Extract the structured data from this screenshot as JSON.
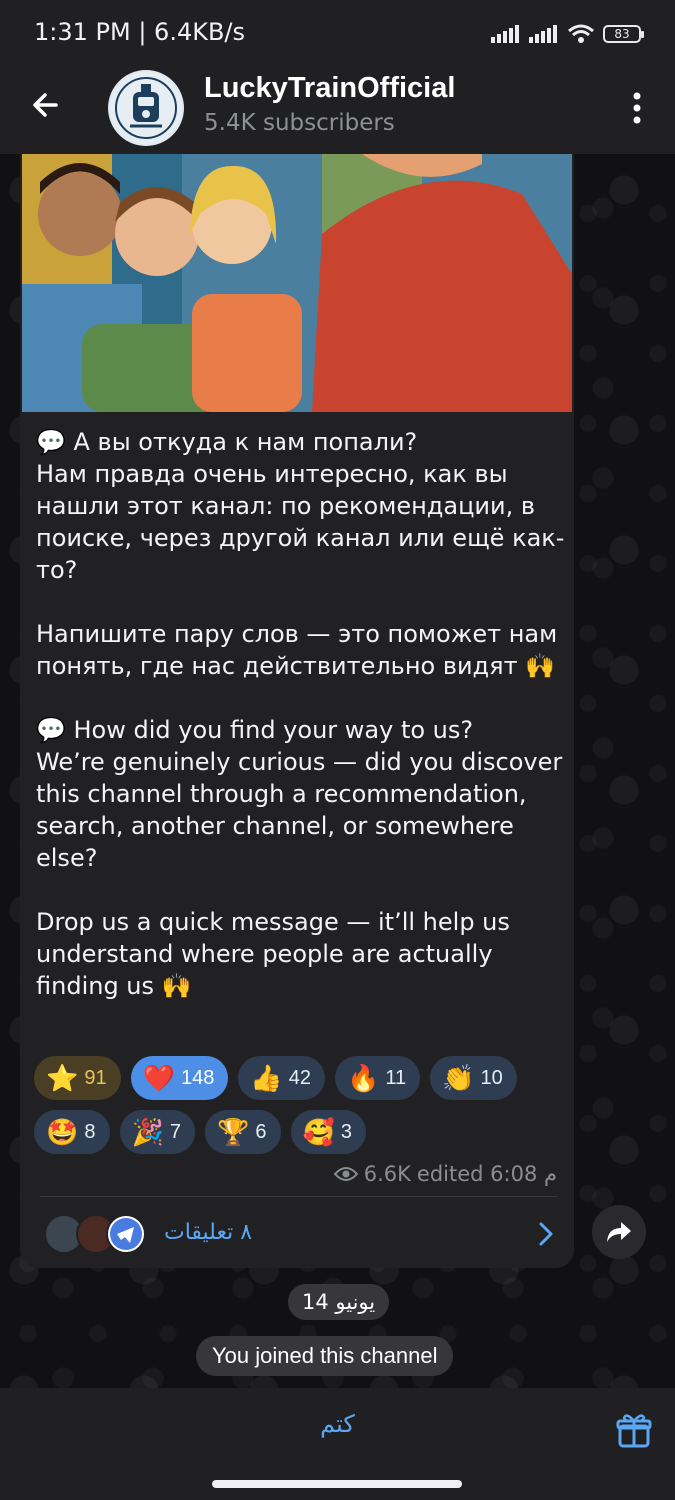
{
  "status_bar": {
    "time": "1:31 PM | 6.4KB/s",
    "battery": "83"
  },
  "header": {
    "title": "LuckyTrainOfficial",
    "subtitle": "5.4K subscribers"
  },
  "post": {
    "text": "💬 А вы откуда к нам попали?\nНам правда очень интересно, как вы нашли этот канал: по рекомендации, в поиске, через другой канал или ещё как-то?\n\nНапишите пару слов — это поможет нам понять, где нас действительно видят 🙌\n\n💬 How did you find your way to us?\nWe’re genuinely curious — did you discover this channel through a recommendation, search, another channel, or somewhere else?\n\nDrop us a quick message — it’ll help us understand where people are actually finding us 🙌",
    "reactions": [
      {
        "emoji": "⭐",
        "count": "91"
      },
      {
        "emoji": "❤️",
        "count": "148"
      },
      {
        "emoji": "👍",
        "count": "42"
      },
      {
        "emoji": "🔥",
        "count": "11"
      },
      {
        "emoji": "👏",
        "count": "10"
      },
      {
        "emoji": "🤩",
        "count": "8"
      },
      {
        "emoji": "🎉",
        "count": "7"
      },
      {
        "emoji": "🏆",
        "count": "6"
      },
      {
        "emoji": "🥰",
        "count": "3"
      }
    ],
    "views": "6.6K",
    "edited": "edited 6:08 م",
    "comments_label": "٨ تعليقات"
  },
  "date_separator": "14 يونيو",
  "joined_notice": "You joined this channel",
  "bottom_bar": {
    "mute_label": "كتم"
  },
  "colors": {
    "accent": "#5aa7f3",
    "bubble": "#212124",
    "header": "#202022",
    "reaction_chosen": "#4d8fe6"
  }
}
